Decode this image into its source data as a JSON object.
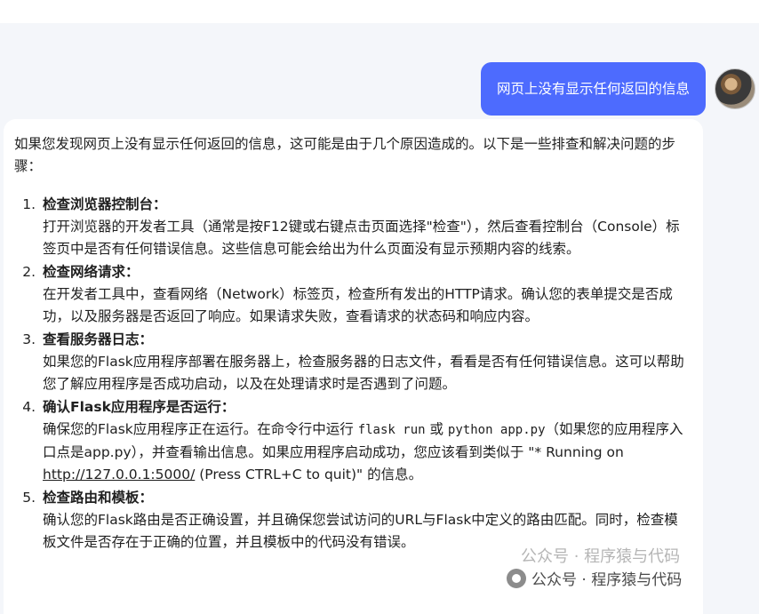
{
  "user_message": "网页上没有显示任何返回的信息",
  "assistant": {
    "intro": "如果您发现网页上没有显示任何返回的信息，这可能是由于几个原因造成的。以下是一些排查和解决问题的步骤：",
    "steps": [
      {
        "num": "1.",
        "title": "检查浏览器控制台：",
        "text": "打开浏览器的开发者工具（通常是按F12键或右键点击页面选择\"检查\"），然后查看控制台（Console）标签页中是否有任何错误信息。这些信息可能会给出为什么页面没有显示预期内容的线索。"
      },
      {
        "num": "2.",
        "title": "检查网络请求：",
        "text": "在开发者工具中，查看网络（Network）标签页，检查所有发出的HTTP请求。确认您的表单提交是否成功，以及服务器是否返回了响应。如果请求失败，查看请求的状态码和响应内容。"
      },
      {
        "num": "3.",
        "title": "查看服务器日志：",
        "text": "如果您的Flask应用程序部署在服务器上，检查服务器的日志文件，看看是否有任何错误信息。这可以帮助您了解应用程序是否成功启动，以及在处理请求时是否遇到了问题。"
      },
      {
        "num": "4.",
        "title": "确认Flask应用程序是否运行：",
        "text_a": "确保您的Flask应用程序正在运行。在命令行中运行 ",
        "code1": "flask run",
        "text_b": " 或 ",
        "code2": "python app.py",
        "text_c": "（如果您的应用程序入口点是app.py），并查看输出信息。如果应用程序启动成功，您应该看到类似于 \"* Running on ",
        "link": "http://127.0.0.1:5000/",
        "text_d": " (Press CTRL+C to quit)\" 的信息。"
      },
      {
        "num": "5.",
        "title": "检查路由和模板：",
        "text": "确认您的Flask路由是否正确设置，并且确保您尝试访问的URL与Flask中定义的路由匹配。同时，检查模板文件是否存在于正确的位置，并且模板中的代码没有错误。"
      }
    ]
  },
  "watermark": {
    "text": "公众号 · 程序猿与代码",
    "ghost_text": "公众号 · 程序猿与代码"
  },
  "colors": {
    "user_bubble": "#4d6bfe",
    "background": "#f4f6fa",
    "card": "#ffffff"
  }
}
